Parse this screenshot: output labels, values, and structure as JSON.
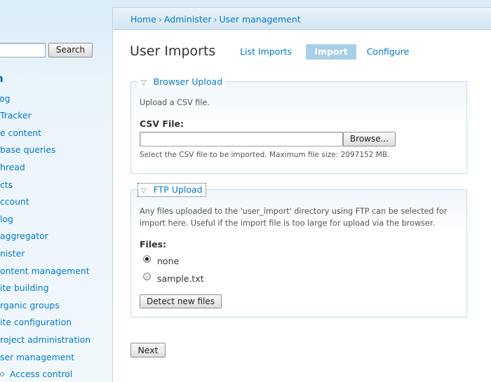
{
  "search": {
    "value": "",
    "button_label": "Search"
  },
  "sidebar": {
    "heading": "n",
    "items": [
      {
        "label": "og"
      },
      {
        "label": "Tracker"
      },
      {
        "label": "e content"
      },
      {
        "label": "base queries"
      },
      {
        "label": "hread"
      },
      {
        "label": "cts"
      },
      {
        "label": "ccount"
      },
      {
        "label": "log"
      },
      {
        "label": " aggregator"
      },
      {
        "label": "nister"
      },
      {
        "label": "ontent management"
      },
      {
        "label": "ite building"
      },
      {
        "label": "rganic groups"
      },
      {
        "label": "ite configuration"
      },
      {
        "label": "roject administration"
      },
      {
        "label": "ser management"
      },
      {
        "label": "Access control"
      }
    ]
  },
  "breadcrumb": {
    "items": [
      "Home",
      "Administer",
      "User management"
    ],
    "separator": "›"
  },
  "page": {
    "title": "User Imports",
    "tabs": [
      {
        "label": "List Imports",
        "active": false
      },
      {
        "label": "Import",
        "active": true
      },
      {
        "label": "Configure",
        "active": false
      }
    ]
  },
  "browser_upload": {
    "legend": "Browser Upload",
    "intro": "Upload a CSV file.",
    "field_label": "CSV File:",
    "file_value": "",
    "browse_label": "Browse...",
    "help": "Select the CSV file to be imported. Maximum file size: 2097152 MB."
  },
  "ftp_upload": {
    "legend": "FTP Upload",
    "help_line1": "Any files uploaded to the 'user_import' directory using FTP can be selected for",
    "help_line2": "import here. Useful if the import file is too large for upload via the browser.",
    "files_label": "Files:",
    "options": [
      {
        "label": "none",
        "checked": true
      },
      {
        "label": "sample.txt",
        "checked": false
      }
    ],
    "detect_label": "Detect new files"
  },
  "next_label": "Next",
  "colors": {
    "link": "#027ac6",
    "active_tab": "#a8cfe8",
    "panel_border": "#c6dcea"
  }
}
